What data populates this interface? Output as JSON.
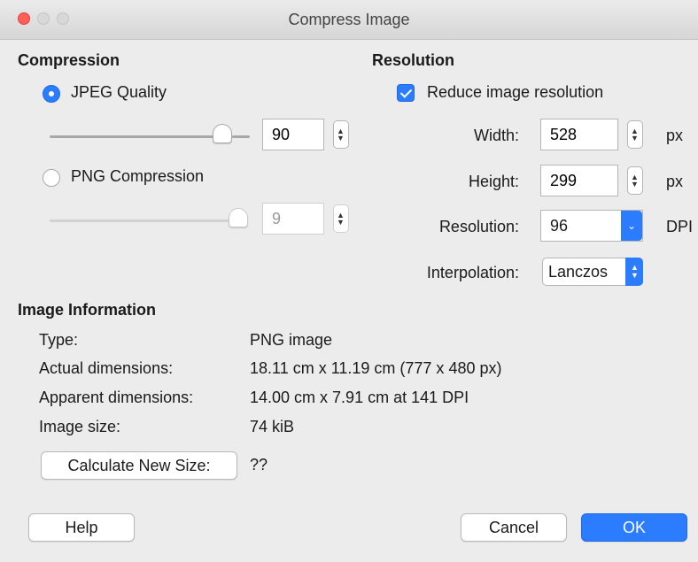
{
  "window": {
    "title": "Compress Image"
  },
  "compression": {
    "heading": "Compression",
    "jpeg": {
      "label": "JPEG Quality",
      "selected": true,
      "value": "90",
      "slider_fraction": 0.9
    },
    "png": {
      "label": "PNG Compression",
      "selected": false,
      "value": "9",
      "slider_fraction": 1.0
    }
  },
  "resolution": {
    "heading": "Resolution",
    "reduce": {
      "label": "Reduce image resolution",
      "checked": true
    },
    "width": {
      "label": "Width:",
      "value": "528",
      "unit": "px"
    },
    "height": {
      "label": "Height:",
      "value": "299",
      "unit": "px"
    },
    "dpi": {
      "label": "Resolution:",
      "value": "96",
      "unit": "DPI"
    },
    "interpolation": {
      "label": "Interpolation:",
      "value": "Lanczos"
    }
  },
  "info": {
    "heading": "Image Information",
    "type": {
      "label": "Type:",
      "value": "PNG image"
    },
    "actual": {
      "label": "Actual dimensions:",
      "value": "18.11 cm x 11.19 cm (777 x 480 px)"
    },
    "apparent": {
      "label": "Apparent dimensions:",
      "value": "14.00 cm x 7.91 cm at 141 DPI"
    },
    "size": {
      "label": "Image size:",
      "value": "74 kiB"
    },
    "calculate_button": "Calculate New Size:",
    "new_size": "??"
  },
  "buttons": {
    "help": "Help",
    "cancel": "Cancel",
    "ok": "OK"
  },
  "colors": {
    "accent": "#2b7cff",
    "close": "#fe5f57"
  }
}
